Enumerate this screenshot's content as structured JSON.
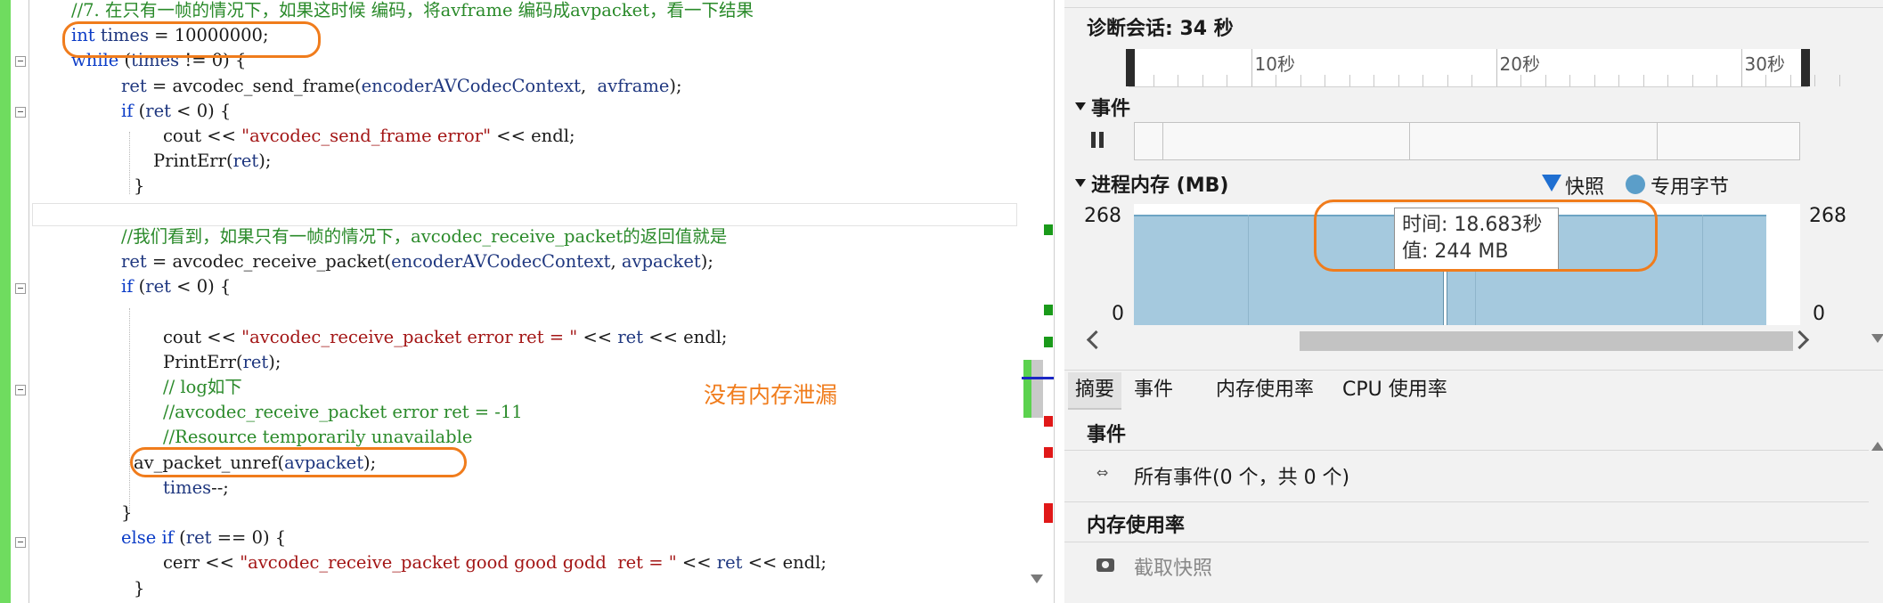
{
  "editor": {
    "lines": [
      {
        "tokens": [
          {
            "c": "cmt",
            "t": "//7. 在只有一帧的情况下，如果这时候 编码，将avframe 编码成avpacket，看一下结果"
          }
        ]
      },
      {
        "tokens": [
          {
            "c": "kw",
            "t": "int"
          },
          {
            "c": "var",
            "t": " times"
          },
          {
            "c": "",
            "t": " = 10000000;"
          }
        ]
      },
      {
        "tokens": [
          {
            "c": "kw",
            "t": "while"
          },
          {
            "c": "",
            "t": " ("
          },
          {
            "c": "var",
            "t": "times"
          },
          {
            "c": "",
            "t": " != 0) {"
          }
        ]
      },
      {
        "tokens": [
          {
            "c": "var",
            "t": "ret"
          },
          {
            "c": "",
            "t": " = "
          },
          {
            "c": "",
            "t": "avcodec_send_frame"
          },
          {
            "c": "",
            "t": "("
          },
          {
            "c": "var",
            "t": "encoderAVCodecContext"
          },
          {
            "c": "",
            "t": ",  "
          },
          {
            "c": "var",
            "t": "avframe"
          },
          {
            "c": "",
            "t": ");"
          }
        ]
      },
      {
        "tokens": [
          {
            "c": "kw",
            "t": "if"
          },
          {
            "c": "",
            "t": " ("
          },
          {
            "c": "var",
            "t": "ret"
          },
          {
            "c": "",
            "t": " < 0) {"
          }
        ]
      },
      {
        "tokens": [
          {
            "c": "",
            "t": "cout << "
          },
          {
            "c": "str",
            "t": "\"avcodec_send_frame error\""
          },
          {
            "c": "",
            "t": " << endl;"
          }
        ]
      },
      {
        "tokens": [
          {
            "c": "",
            "t": "PrintErr("
          },
          {
            "c": "var",
            "t": "ret"
          },
          {
            "c": "",
            "t": ");"
          }
        ]
      },
      {
        "tokens": [
          {
            "c": "",
            "t": "}"
          }
        ]
      },
      {
        "tokens": []
      },
      {
        "tokens": [
          {
            "c": "cmt",
            "t": "//我们看到，如果只有一帧的情况下，avcodec_receive_packet的返回值就是"
          }
        ]
      },
      {
        "tokens": [
          {
            "c": "var",
            "t": "ret"
          },
          {
            "c": "",
            "t": " = avcodec_receive_packet("
          },
          {
            "c": "var",
            "t": "encoderAVCodecContext"
          },
          {
            "c": "",
            "t": ", "
          },
          {
            "c": "var",
            "t": "avpacket"
          },
          {
            "c": "",
            "t": ");"
          }
        ]
      },
      {
        "tokens": [
          {
            "c": "kw",
            "t": "if"
          },
          {
            "c": "",
            "t": " ("
          },
          {
            "c": "var",
            "t": "ret"
          },
          {
            "c": "",
            "t": " < 0) {"
          }
        ]
      },
      {
        "tokens": []
      },
      {
        "tokens": [
          {
            "c": "",
            "t": "cout << "
          },
          {
            "c": "str",
            "t": "\"avcodec_receive_packet error ret = \""
          },
          {
            "c": "",
            "t": " << "
          },
          {
            "c": "var",
            "t": "ret"
          },
          {
            "c": "",
            "t": " << endl;"
          }
        ]
      },
      {
        "tokens": [
          {
            "c": "",
            "t": "PrintErr("
          },
          {
            "c": "var",
            "t": "ret"
          },
          {
            "c": "",
            "t": ");"
          }
        ]
      },
      {
        "tokens": [
          {
            "c": "cmt",
            "t": "// log如下"
          }
        ]
      },
      {
        "tokens": [
          {
            "c": "cmt",
            "t": "//avcodec_receive_packet error ret = -11"
          }
        ]
      },
      {
        "tokens": [
          {
            "c": "cmt",
            "t": "//Resource temporarily unavailable"
          }
        ]
      },
      {
        "tokens": [
          {
            "c": "",
            "t": "av_packet_unref("
          },
          {
            "c": "var",
            "t": "avpacket"
          },
          {
            "c": "",
            "t": ");"
          }
        ]
      },
      {
        "tokens": [
          {
            "c": "var",
            "t": "times"
          },
          {
            "c": "",
            "t": "--;"
          }
        ]
      },
      {
        "tokens": [
          {
            "c": "",
            "t": "}"
          }
        ]
      },
      {
        "tokens": [
          {
            "c": "kw",
            "t": "else if"
          },
          {
            "c": "",
            "t": " ("
          },
          {
            "c": "var",
            "t": "ret"
          },
          {
            "c": "",
            "t": " == 0) {"
          }
        ]
      },
      {
        "tokens": [
          {
            "c": "",
            "t": "cerr << "
          },
          {
            "c": "str",
            "t": "\"avcodec_receive_packet good good godd  ret = \""
          },
          {
            "c": "",
            "t": " << "
          },
          {
            "c": "var",
            "t": "ret"
          },
          {
            "c": "",
            "t": " << endl;"
          }
        ]
      },
      {
        "tokens": [
          {
            "c": "",
            "t": "}"
          }
        ]
      }
    ],
    "annotation_note": "没有内存泄漏",
    "overview_colors": {
      "green": "#1a9a1a",
      "red": "#e01818"
    }
  },
  "diagnostics": {
    "session_label": "诊断会话: 34 秒",
    "ruler_labels": [
      "10秒",
      "20秒",
      "30秒"
    ],
    "events_section": "事件",
    "memory_section": "进程内存 (MB)",
    "legend": {
      "snapshot": "快照",
      "private_bytes": "专用字节"
    },
    "legend_colors": {
      "snapshot": "#1f6fd1",
      "private_bytes": "#5b9ec9"
    },
    "y_top_left": "268",
    "y_bottom_left": "0",
    "y_top_right": "268",
    "y_bottom_right": "0",
    "tooltip": {
      "time": "时间: 18.683秒",
      "value": "值: 244 MB"
    },
    "tabs": [
      {
        "label": "摘要",
        "active": true
      },
      {
        "label": "事件",
        "active": false
      },
      {
        "label": "内存使用率",
        "active": false
      },
      {
        "label": "CPU 使用率",
        "active": false
      }
    ],
    "summary": {
      "events_header": "事件",
      "events_link": "所有事件(0 个，共 0 个)",
      "memory_header": "内存使用率",
      "snapshot_button": "截取快照"
    }
  },
  "chart_data": {
    "type": "area",
    "title": "进程内存 (MB)",
    "xlabel": "",
    "ylabel": "",
    "ylim": [
      0,
      268
    ],
    "x_ticks": [
      "10秒",
      "20秒",
      "30秒"
    ],
    "series": [
      {
        "name": "专用字节",
        "x": [
          0.8,
          1.0,
          34.0
        ],
        "y": [
          244,
          244,
          244
        ]
      }
    ],
    "markers": [
      {
        "name": "快照",
        "x": 18.683,
        "y": 244
      }
    ],
    "legend": "top-right",
    "grid": true
  }
}
